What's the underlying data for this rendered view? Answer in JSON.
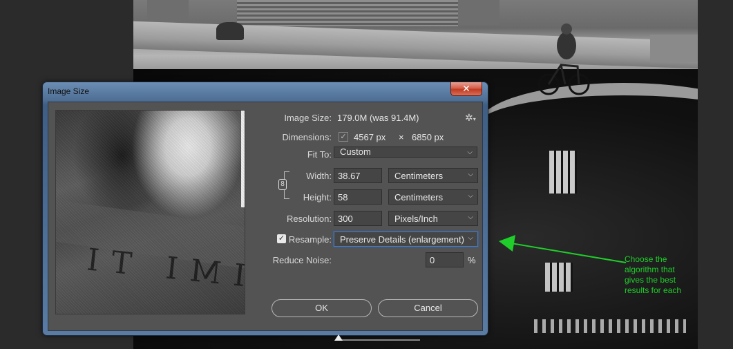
{
  "dialog": {
    "title": "Image Size",
    "close_label": "✕"
  },
  "image_size": {
    "label": "Image Size:",
    "value": "179.0M (was 91.4M)"
  },
  "dimensions": {
    "label": "Dimensions:",
    "width": "4567 px",
    "times": "×",
    "height": "6850 px"
  },
  "fit_to": {
    "label": "Fit To:",
    "value": "Custom"
  },
  "width": {
    "label": "Width:",
    "value": "38.67",
    "unit": "Centimeters"
  },
  "height": {
    "label": "Height:",
    "value": "58",
    "unit": "Centimeters"
  },
  "resolution": {
    "label": "Resolution:",
    "value": "300",
    "unit": "Pixels/Inch"
  },
  "resample": {
    "label": "Resample:",
    "checked": true,
    "value": "Preserve Details (enlargement)"
  },
  "reduce_noise": {
    "label": "Reduce Noise:",
    "value": "0",
    "unit": "%"
  },
  "buttons": {
    "ok": "OK",
    "cancel": "Cancel"
  },
  "annotation": {
    "text": "Choose the algorithm that gives the best results for each"
  },
  "colors": {
    "annotation": "#1fce2a",
    "focus_border": "#4b79b7"
  },
  "icons": {
    "gear": "gear-icon",
    "link": "link-icon",
    "check": "checkmark-icon",
    "chevron": "chevron-down-icon"
  }
}
